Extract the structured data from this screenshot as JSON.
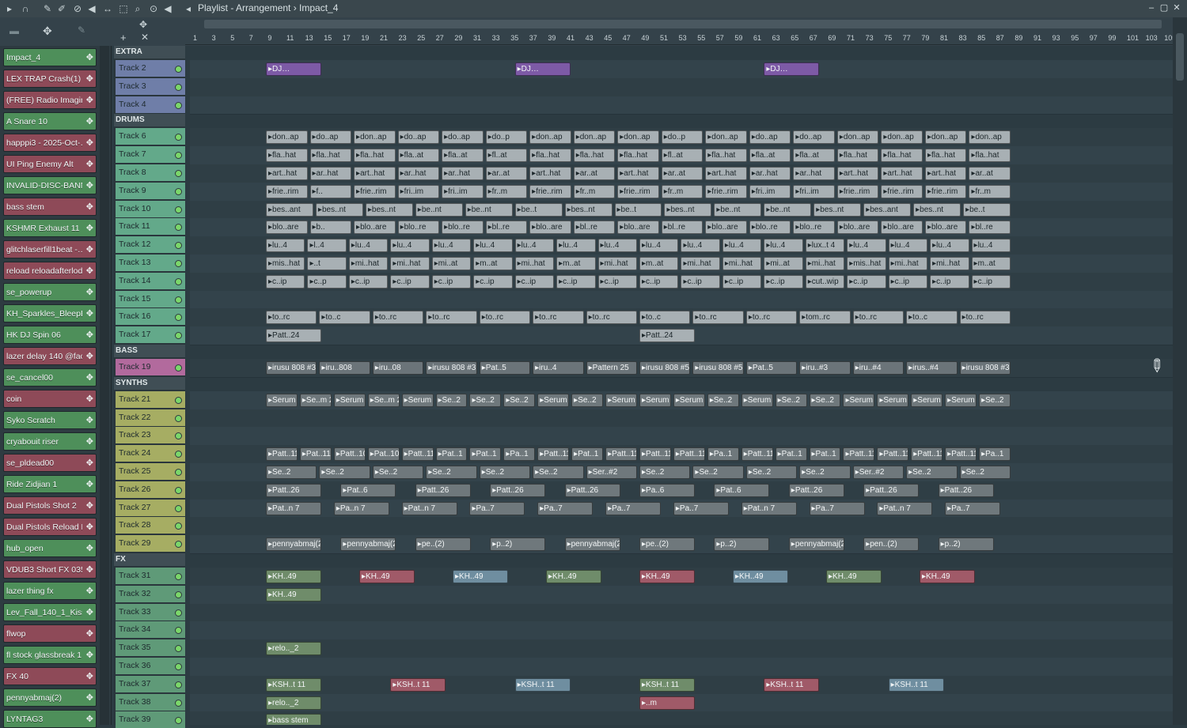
{
  "window": {
    "title": "Playlist - Arrangement › Impact_4",
    "icons": [
      "play-arrow-icon",
      "magnet-icon",
      "pencil-icon",
      "brush-icon",
      "delete-icon",
      "mute-icon",
      "slip-icon",
      "select-icon",
      "zoom-icon",
      "playback-icon"
    ]
  },
  "ruler": [
    "1",
    "3",
    "5",
    "7",
    "9",
    "11",
    "13",
    "15",
    "17",
    "19",
    "21",
    "23",
    "25",
    "27",
    "29",
    "31",
    "33",
    "35",
    "37",
    "39",
    "41",
    "43",
    "45",
    "47",
    "49",
    "51",
    "53",
    "55",
    "57",
    "59",
    "61",
    "63",
    "65",
    "67",
    "69",
    "71",
    "73",
    "75",
    "77",
    "79",
    "81",
    "83",
    "85",
    "87",
    "89",
    "91",
    "93",
    "95",
    "97",
    "99",
    "101",
    "103",
    "105"
  ],
  "picker": [
    {
      "label": "Impact_4",
      "color": "#4e8f5a"
    },
    {
      "label": "LEX TRAP Crash(1)",
      "color": "#8e4a58"
    },
    {
      "label": "(FREE) Radio Imaging…",
      "color": "#8e4a58"
    },
    {
      "label": "A Snare 10",
      "color": "#4e8f5a"
    },
    {
      "label": "happpi3 - 2025-Oct-…",
      "color": "#8e4a58"
    },
    {
      "label": "UI Ping Enemy Alt",
      "color": "#8e4a58"
    },
    {
      "label": "INVALID-DISC-BANNER",
      "color": "#4e8f5a"
    },
    {
      "label": "bass stem",
      "color": "#8e4a58"
    },
    {
      "label": "KSHMR Exhaust 11",
      "color": "#4e8f5a"
    },
    {
      "label": "glitchlaserfill1beat -…",
      "color": "#8e4a58"
    },
    {
      "label": "reload reloadafterlod…",
      "color": "#8e4a58"
    },
    {
      "label": "se_powerup",
      "color": "#4e8f5a"
    },
    {
      "label": "KH_Sparkles_BleepBl…",
      "color": "#4e8f5a"
    },
    {
      "label": "HK DJ Spin 06",
      "color": "#4e8f5a"
    },
    {
      "label": "lazer delay 140 @fac…",
      "color": "#8e4a58"
    },
    {
      "label": "se_cancel00",
      "color": "#4e8f5a"
    },
    {
      "label": "coin",
      "color": "#8e4a58"
    },
    {
      "label": "Syko Scratch",
      "color": "#4e8f5a"
    },
    {
      "label": "cryabouit riser",
      "color": "#4e8f5a"
    },
    {
      "label": "se_pldead00",
      "color": "#8e4a58"
    },
    {
      "label": "Ride Zidjian 1",
      "color": "#4e8f5a"
    },
    {
      "label": "Dual Pistols Shot 2",
      "color": "#8e4a58"
    },
    {
      "label": "Dual Pistols Reload M…",
      "color": "#8e4a58"
    },
    {
      "label": "hub_open",
      "color": "#4e8f5a"
    },
    {
      "label": "VDUB3 Short FX 035",
      "color": "#8e4a58"
    },
    {
      "label": "lazer thing fx",
      "color": "#4e8f5a"
    },
    {
      "label": "Lev_Fall_140_1_Kisser",
      "color": "#4e8f5a"
    },
    {
      "label": "flwop",
      "color": "#8e4a58"
    },
    {
      "label": "fl stock glassbreak 1",
      "color": "#4e8f5a"
    },
    {
      "label": "FX 40",
      "color": "#8e4a58"
    },
    {
      "label": "pennyabmaj(2)",
      "color": "#4e8f5a"
    },
    {
      "label": "LYNTAG3",
      "color": "#4e8f5a"
    }
  ],
  "groups": [
    {
      "label": "EXTRA",
      "tracks": [
        {
          "label": "Track 2"
        },
        {
          "label": "Track 3"
        },
        {
          "label": "Track 4"
        }
      ],
      "color": "#6f7ea8"
    },
    {
      "label": "DRUMS",
      "tracks": [
        {
          "label": "Track 6"
        },
        {
          "label": "Track 7"
        },
        {
          "label": "Track 8"
        },
        {
          "label": "Track 9"
        },
        {
          "label": "Track 10"
        },
        {
          "label": "Track 11"
        },
        {
          "label": "Track 12"
        },
        {
          "label": "Track 13"
        },
        {
          "label": "Track 14"
        },
        {
          "label": "Track 15"
        },
        {
          "label": "Track 16"
        },
        {
          "label": "Track 17"
        }
      ],
      "color": "#63a98a"
    },
    {
      "label": "BASS",
      "tracks": [
        {
          "label": "Track 19"
        }
      ],
      "color": "#b26a9d"
    },
    {
      "label": "SYNTHS",
      "tracks": [
        {
          "label": "Track 21"
        },
        {
          "label": "Track 22"
        },
        {
          "label": "Track 23"
        },
        {
          "label": "Track 24"
        },
        {
          "label": "Track 25"
        },
        {
          "label": "Track 26"
        },
        {
          "label": "Track 27"
        },
        {
          "label": "Track 28"
        },
        {
          "label": "Track 29"
        }
      ],
      "color": "#a6ad63"
    },
    {
      "label": "FX",
      "tracks": [
        {
          "label": "Track 31"
        },
        {
          "label": "Track 32"
        },
        {
          "label": "Track 33"
        },
        {
          "label": "Track 34"
        },
        {
          "label": "Track 35"
        },
        {
          "label": "Track 36"
        },
        {
          "label": "Track 37"
        },
        {
          "label": "Track 38"
        },
        {
          "label": "Track 39"
        }
      ],
      "color": "#5f9a78"
    }
  ],
  "clips": {
    "track2": [
      "DJ…",
      "DJ…",
      "DJ…"
    ],
    "track6": [
      "don..ap",
      "do..ap",
      "don..ap",
      "do..ap",
      "do..ap",
      "do..p",
      "don..ap",
      "don..ap",
      "don..ap",
      "do..p",
      "don..ap",
      "do..ap",
      "do..ap",
      "don..ap",
      "don..ap",
      "don..ap",
      "don..ap"
    ],
    "track7": [
      "fla..hat",
      "fla..hat",
      "fla..hat",
      "fla..at",
      "fla..at",
      "fl..at",
      "fla..hat",
      "fla..hat",
      "fla..hat",
      "fl..at",
      "fla..hat",
      "fla..at",
      "fla..at",
      "fla..hat",
      "fla..hat",
      "fla..hat",
      "fla..hat"
    ],
    "track8": [
      "art..hat",
      "ar..hat",
      "art..hat",
      "ar..hat",
      "ar..hat",
      "ar..at",
      "art..hat",
      "ar..at",
      "art..hat",
      "ar..at",
      "art..hat",
      "ar..hat",
      "ar..hat",
      "art..hat",
      "art..hat",
      "art..hat",
      "ar..at"
    ],
    "track9": [
      "frie..rim",
      "f..",
      "frie..rim",
      "fri..im",
      "fri..im",
      "fr..m",
      "frie..rim",
      "fr..m",
      "frie..rim",
      "fr..m",
      "frie..rim",
      "fri..im",
      "fri..im",
      "frie..rim",
      "frie..rim",
      "frie..rim",
      "fr..m"
    ],
    "track10": [
      "bes..ant",
      "bes..nt",
      "bes..nt",
      "be..nt",
      "be..nt",
      "be..t",
      "bes..nt",
      "be..t",
      "bes..nt",
      "be..nt",
      "be..nt",
      "bes..nt",
      "bes..ant",
      "bes..nt",
      "be..t"
    ],
    "track11": [
      "blo..are",
      "b..",
      "blo..are",
      "blo..re",
      "blo..re",
      "bl..re",
      "blo..are",
      "bl..re",
      "blo..are",
      "bl..re",
      "blo..are",
      "blo..re",
      "blo..re",
      "blo..are",
      "blo..are",
      "blo..are",
      "bl..re"
    ],
    "track12": [
      "lu..4",
      "l..4",
      "lu..4",
      "lu..4",
      "lu..4",
      "lu..4",
      "lu..4",
      "lu..4",
      "lu..4",
      "lu..4",
      "lu..4",
      "lu..4",
      "lu..4",
      "lux..t 4",
      "lu..4",
      "lu..4",
      "lu..4",
      "lu..4"
    ],
    "track13": [
      "mis..hat",
      "..t",
      "mi..hat",
      "mi..hat",
      "mi..at",
      "m..at",
      "mi..hat",
      "m..at",
      "mi..hat",
      "m..at",
      "mi..hat",
      "mi..hat",
      "mi..at",
      "mi..hat",
      "mis..hat",
      "mi..hat",
      "mi..hat",
      "m..at"
    ],
    "track14": [
      "c..ip",
      "c..p",
      "c..ip",
      "c..ip",
      "c..ip",
      "c..ip",
      "c..ip",
      "c..ip",
      "c..ip",
      "c..ip",
      "c..ip",
      "c..ip",
      "c..ip",
      "cut..wip",
      "c..ip",
      "c..ip",
      "c..ip",
      "c..ip"
    ],
    "track16": [
      "to..rc",
      "to..c",
      "to..rc",
      "to..rc",
      "to..rc",
      "to..rc",
      "to..rc",
      "to..c",
      "to..rc",
      "to..rc",
      "tom..rc",
      "to..rc",
      "to..c",
      "to..rc"
    ],
    "track17": [
      "Patt..24",
      "Patt..24"
    ],
    "track19": [
      "irusu 808 #3",
      "iru..808",
      "iru..08",
      "irusu 808 #3",
      "Pat..5",
      "iru..4",
      "Pattern 25",
      "irusu 808 #5",
      "irusu 808 #5",
      "Pat..5",
      "iru..#3",
      "iru..#4",
      "irus..#4",
      "irusu 808 #3"
    ],
    "track21": [
      "Serum 2",
      "Se..m 2",
      "Serum 2",
      "Se..m 2",
      "Serum 2",
      "Se..2",
      "Se..2",
      "Se..2",
      "Serum 2",
      "Se..2",
      "Serum 2",
      "Serum 2",
      "Serum 2",
      "Se..2",
      "Serum 2",
      "Se..2",
      "Se..2",
      "Serum 2",
      "Serum 2",
      "Serum 2",
      "Serum 2",
      "Se..2"
    ],
    "track24": [
      "Patt..11",
      "Pat..11",
      "Patt..10",
      "Pat..10",
      "Patt..11",
      "Pat..1",
      "Pat..1",
      "Pa..1",
      "Patt..11",
      "Pat..1",
      "Patt..11",
      "Patt..11",
      "Patt..11",
      "Pa..1",
      "Patt..11",
      "Pat..1",
      "Pat..1",
      "Patt..11",
      "Patt..11",
      "Patt..11",
      "Patt..11",
      "Pa..1"
    ],
    "track25": [
      "Se..2",
      "Se..2",
      "Se..2",
      "Se..2",
      "Se..2",
      "Se..2",
      "Ser..#2",
      "Se..2",
      "Se..2",
      "Se..2",
      "Se..2",
      "Ser..#2",
      "Se..2",
      "Se..2"
    ],
    "track26": [
      "Patt..26",
      "Pat..6",
      "Patt..26",
      "Patt..26",
      "Patt..26",
      "Pa..6",
      "Pat..6",
      "Patt..26",
      "Patt..26",
      "Patt..26"
    ],
    "track27": [
      "Pat..n 7",
      "Pa..n 7",
      "Pat..n 7",
      "Pa..7",
      "Pa..7",
      "Pa..7",
      "Pa..7",
      "Pat..n 7",
      "Pa..7",
      "Pat..n 7",
      "Pa..7"
    ],
    "track29": [
      "pennyabmaj(2)",
      "pennyabmaj(2)",
      "pe..(2)",
      "p..2)",
      "pennyabmaj(2)",
      "pe..(2)",
      "p..2)",
      "pennyabmaj(2)",
      "pen..(2)",
      "p..2)"
    ],
    "track31": [
      "KH..49",
      "KH..49",
      "KH..49",
      "KH..49",
      "KH..49",
      "KH..49",
      "KH..49",
      "KH..49"
    ],
    "track32": [
      "KH..49"
    ],
    "track35": [
      "relo.._2"
    ],
    "track37": [
      "KSH..t 11",
      "KSH..t 11",
      "KSH..t 11",
      "KSH..t 11",
      "KSH..t 11",
      "KSH..t 11"
    ],
    "track38": [
      "relo.._2",
      "..m"
    ],
    "track39": [
      "bass stem"
    ]
  },
  "colors": {
    "drums_clip": "#a8b0b4",
    "bass_clip": "#6b7479",
    "synth_clip": "#6f787c",
    "extra_clip": "#7d5aa6",
    "fx_green": "#6f8c6a",
    "fx_red": "#a05a68",
    "fx_blue": "#6f8ea0"
  }
}
